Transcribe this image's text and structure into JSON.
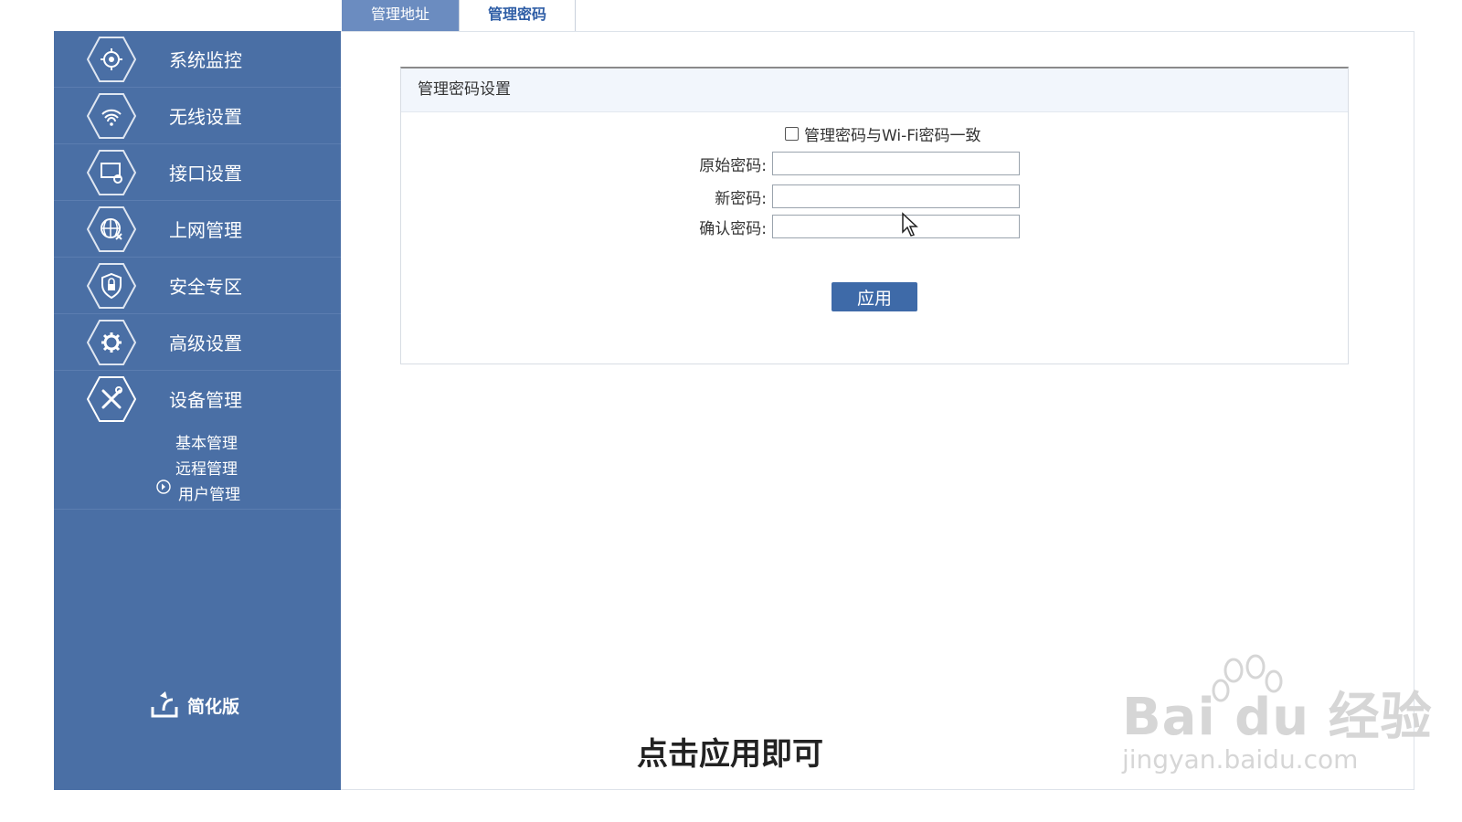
{
  "tabs": [
    {
      "label": "管理地址",
      "active": false
    },
    {
      "label": "管理密码",
      "active": true
    }
  ],
  "sidebar": {
    "items": [
      {
        "label": "系统监控",
        "icon": "system-monitor-icon"
      },
      {
        "label": "无线设置",
        "icon": "wireless-icon"
      },
      {
        "label": "接口设置",
        "icon": "interface-icon"
      },
      {
        "label": "上网管理",
        "icon": "internet-icon"
      },
      {
        "label": "安全专区",
        "icon": "security-icon"
      },
      {
        "label": "高级设置",
        "icon": "gear-icon"
      },
      {
        "label": "设备管理",
        "icon": "tools-icon"
      }
    ],
    "sub_items": [
      {
        "label": "基本管理"
      },
      {
        "label": "远程管理"
      },
      {
        "label": "用户管理",
        "active": true
      }
    ],
    "simplified_label": "简化版"
  },
  "panel": {
    "title": "管理密码设置",
    "checkbox_label": "管理密码与Wi-Fi密码一致",
    "checkbox_checked": false,
    "fields": [
      {
        "label": "原始密码:",
        "value": ""
      },
      {
        "label": "新密码:",
        "value": ""
      },
      {
        "label": "确认密码:",
        "value": ""
      }
    ],
    "apply_label": "应用"
  },
  "subtitle": "点击应用即可",
  "watermark": {
    "main": "Bai  du 经验",
    "url": "jingyan.baidu.com"
  },
  "colors": {
    "sidebar": "#4a6fa5",
    "accent": "#3e6aa8",
    "tab_inactive": "#6b8cc0"
  }
}
